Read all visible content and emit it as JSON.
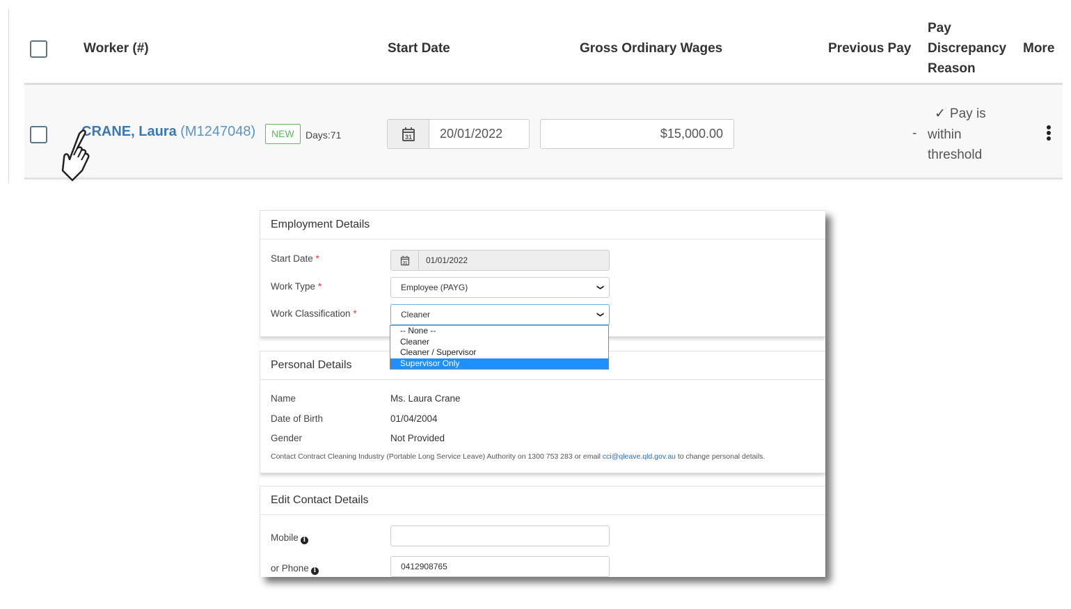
{
  "table": {
    "headers": {
      "worker": "Worker (#)",
      "start_date": "Start Date",
      "gross_wages": "Gross Ordinary Wages",
      "previous_pay": "Previous Pay",
      "discrepancy_line1": "Pay",
      "discrepancy_line2": "Discrepancy",
      "discrepancy_line3": "Reason",
      "more": "More"
    },
    "rows": [
      {
        "worker_name": "CRANE, Laura",
        "worker_number": "(M1247048)",
        "badge": "NEW",
        "days": "Days:71",
        "start_date": "20/01/2022",
        "gross_wages": "$15,000.00",
        "previous_pay": "-",
        "reason_check": "✓",
        "reason_line1": "Pay is",
        "reason_line2": "within",
        "reason_line3": "threshold"
      }
    ]
  },
  "employment": {
    "title": "Employment Details",
    "start_date_label": "Start Date",
    "start_date_value": "01/01/2022",
    "work_type_label": "Work Type",
    "work_type_value": "Employee (PAYG)",
    "work_class_label": "Work Classification",
    "work_class_value": "Cleaner",
    "required_mark": "*",
    "work_class_options": [
      "-- None --",
      "Cleaner",
      "Cleaner / Supervisor",
      "Supervisor Only"
    ],
    "highlighted_option": "Supervisor Only"
  },
  "personal": {
    "title": "Personal Details",
    "name_label": "Name",
    "name_value": "Ms. Laura Crane",
    "dob_label": "Date of Birth",
    "dob_value": "01/04/2004",
    "gender_label": "Gender",
    "gender_value": "Not Provided",
    "note_before": "Contact Contract Cleaning Industry (Portable Long Service Leave) Authority on 1300 753 283 or email ",
    "note_email": "cci@qleave.qld.gov.au",
    "note_after": " to change personal details."
  },
  "contact": {
    "title": "Edit Contact Details",
    "mobile_label": "Mobile",
    "mobile_value": "",
    "phone_label": "or Phone",
    "phone_value": "0412908765"
  },
  "colors": {
    "link": "#3a78b5",
    "badge_new": "#5cb85c",
    "required": "#e03a3a",
    "option_highlight": "#1e90ff"
  }
}
